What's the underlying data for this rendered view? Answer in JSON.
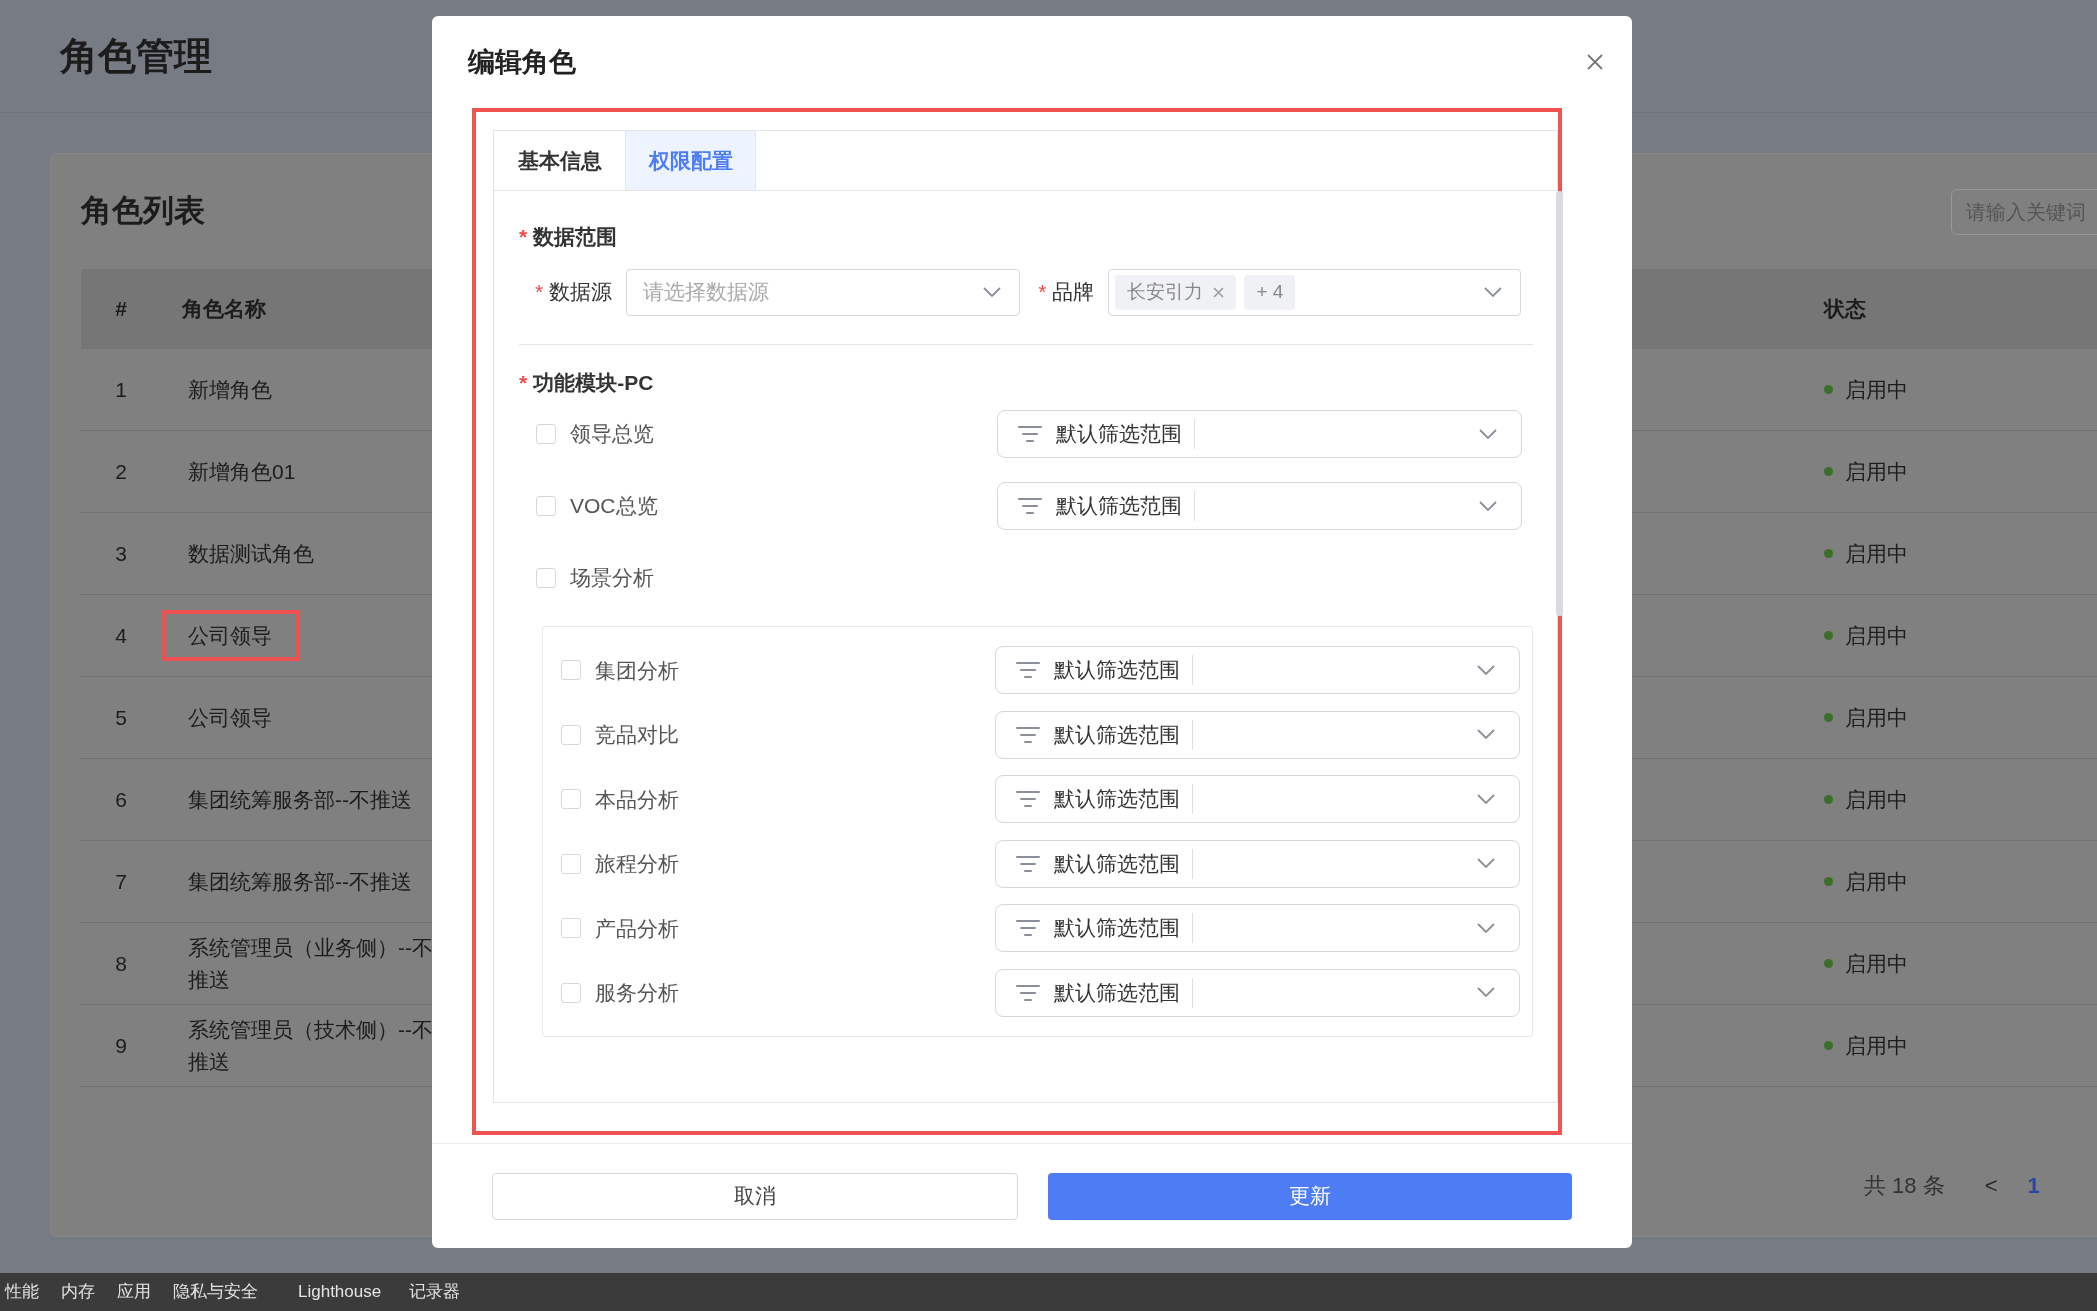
{
  "page": {
    "title": "角色管理"
  },
  "card": {
    "title": "角色列表",
    "search": {
      "placeholder": "请输入关键词"
    }
  },
  "table": {
    "columns": [
      "#",
      "角色名称",
      "状态"
    ],
    "rows": [
      {
        "index": "1",
        "name": "新增角色",
        "status": "启用中",
        "highlighted": false
      },
      {
        "index": "2",
        "name": "新增角色01",
        "status": "启用中",
        "highlighted": false
      },
      {
        "index": "3",
        "name": "数据测试角色",
        "status": "启用中",
        "highlighted": false
      },
      {
        "index": "4",
        "name": "公司领导",
        "status": "启用中",
        "highlighted": true
      },
      {
        "index": "5",
        "name": "公司领导",
        "status": "启用中",
        "highlighted": false
      },
      {
        "index": "6",
        "name": "集团统筹服务部--不推送",
        "status": "启用中",
        "highlighted": false
      },
      {
        "index": "7",
        "name": "集团统筹服务部--不推送",
        "status": "启用中",
        "highlighted": false
      },
      {
        "index": "8",
        "name": "系统管理员（业务侧）--不推送",
        "status": "启用中",
        "highlighted": false
      },
      {
        "index": "9",
        "name": "系统管理员（技术侧）--不推送",
        "status": "启用中",
        "highlighted": false
      }
    ]
  },
  "pagination": {
    "total": "共 18 条",
    "prev": "<",
    "pages": [
      {
        "label": "1",
        "selected": true
      }
    ]
  },
  "dialog": {
    "title": "编辑角色",
    "highlighted": true,
    "tabs": [
      {
        "label": "基本信息",
        "selected": false
      },
      {
        "label": "权限配置",
        "selected": true
      }
    ],
    "data_scope": {
      "title": "数据范围",
      "required_mark": "*",
      "fields": [
        {
          "label": "数据源",
          "required_mark": "*",
          "placeholder": "请选择数据源"
        },
        {
          "label": "品牌",
          "required_mark": "*",
          "tags": [
            {
              "text": "长安引力",
              "removable": true
            },
            {
              "text": "+ 4",
              "removable": false
            }
          ]
        }
      ]
    },
    "modules": {
      "title": "功能模块-PC",
      "required_mark": "*",
      "items": [
        {
          "label": "领导总览",
          "checked": false,
          "scope": "默认筛选范围"
        },
        {
          "label": "VOC总览",
          "checked": false,
          "scope": "默认筛选范围"
        },
        {
          "label": "场景分析",
          "checked": false,
          "children": [
            {
              "label": "集团分析",
              "checked": false,
              "scope": "默认筛选范围"
            },
            {
              "label": "竞品对比",
              "checked": false,
              "scope": "默认筛选范围"
            },
            {
              "label": "本品分析",
              "checked": false,
              "scope": "默认筛选范围"
            },
            {
              "label": "旅程分析",
              "checked": false,
              "scope": "默认筛选范围"
            },
            {
              "label": "产品分析",
              "checked": false,
              "scope": "默认筛选范围"
            },
            {
              "label": "服务分析",
              "checked": false,
              "scope": "默认筛选范围"
            }
          ]
        }
      ]
    },
    "buttons": [
      {
        "label": "取消",
        "kind": "secondary"
      },
      {
        "label": "更新",
        "kind": "primary"
      }
    ]
  },
  "devtools": {
    "tabs": [
      "性能",
      "内存",
      "应用",
      "隐私与安全",
      "Lighthouse",
      "记录器"
    ]
  }
}
